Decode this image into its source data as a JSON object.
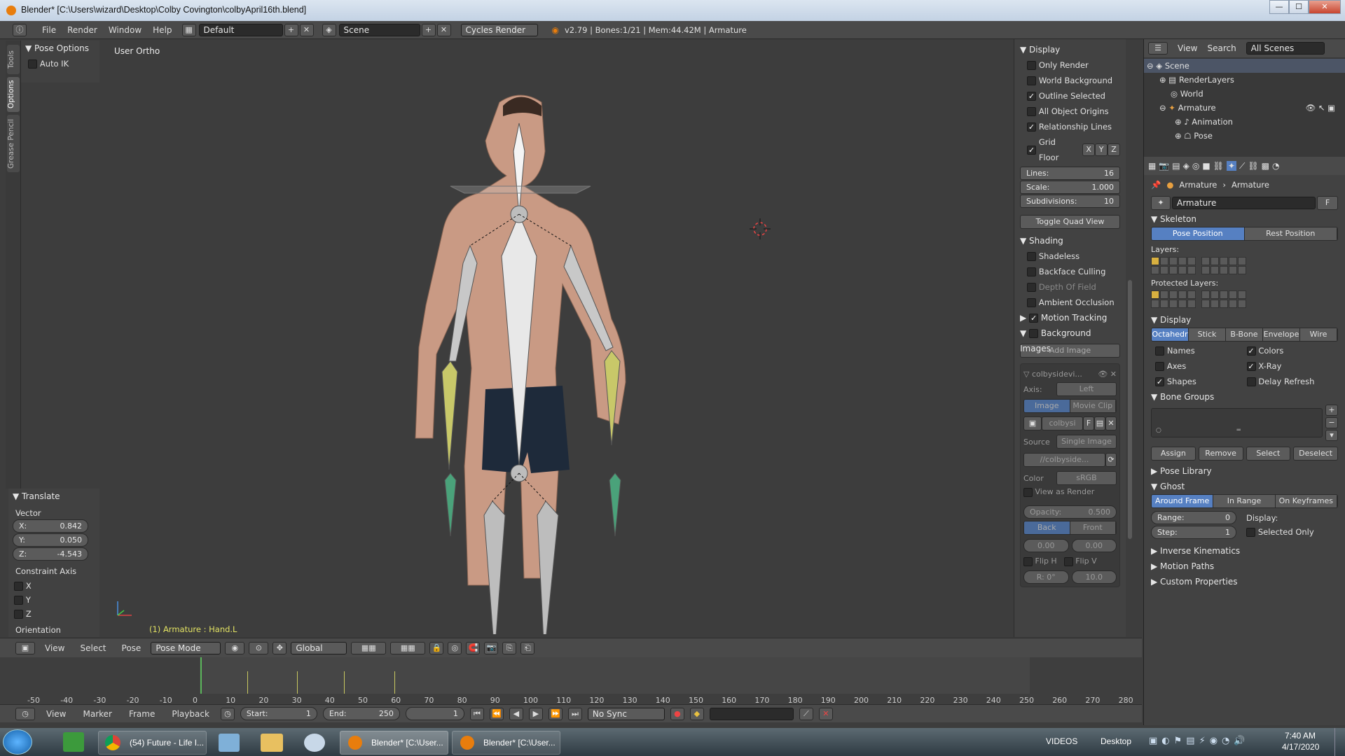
{
  "window": {
    "title": "Blender* [C:\\Users\\wizard\\Desktop\\Colby Covington\\colbyApril16th.blend]",
    "min": "—",
    "max": "☐",
    "close": "✕"
  },
  "infobar": {
    "menus": [
      "File",
      "Render",
      "Window",
      "Help"
    ],
    "layout": "Default",
    "scene": "Scene",
    "engine": "Cycles Render",
    "stats": "v2.79 | Bones:1/21 | Mem:44.42M | Armature"
  },
  "tool_tabs": [
    "Tools",
    "Options",
    "Grease Pencil"
  ],
  "pose_options": {
    "title": "Pose Options",
    "auto_ik": "Auto IK"
  },
  "translate": {
    "title": "Translate",
    "vector_label": "Vector",
    "x": "X:",
    "xv": "0.842",
    "y": "Y:",
    "yv": "0.050",
    "z": "Z:",
    "zv": "-4.543",
    "constraint_label": "Constraint Axis",
    "cx": "X",
    "cy": "Y",
    "cz": "Z",
    "orientation": "Orientation"
  },
  "viewport": {
    "view_label": "User Ortho",
    "status": "(1) Armature : Hand.L"
  },
  "display_panel": {
    "title": "Display",
    "only_render": "Only Render",
    "world_bg": "World Background",
    "outline_sel": "Outline Selected",
    "all_origins": "All Object Origins",
    "rel_lines": "Relationship Lines",
    "grid_floor": "Grid Floor",
    "gx": "X",
    "gy": "Y",
    "gz": "Z",
    "lines": "Lines:",
    "lines_v": "16",
    "scale": "Scale:",
    "scale_v": "1.000",
    "subdiv": "Subdivisions:",
    "subdiv_v": "10",
    "toggle_quad": "Toggle Quad View"
  },
  "shading_panel": {
    "title": "Shading",
    "shadeless": "Shadeless",
    "backface": "Backface Culling",
    "dof": "Depth Of Field",
    "ao": "Ambient Occlusion"
  },
  "motion_tracking": "Motion Tracking",
  "bg_images": {
    "title": "Background Images",
    "add": "Add Image",
    "name": "colbysidevi...",
    "axis_label": "Axis:",
    "axis_v": "Left",
    "image": "Image",
    "movie": "Movie Clip",
    "file": "colbysi",
    "f": "F",
    "source_label": "Source",
    "source_v": "Single Image",
    "path": "//colbyside...",
    "color_label": "Color",
    "color_v": "sRGB",
    "view_render": "View as Render",
    "opacity": "Opacity:",
    "opacity_v": "0.500",
    "back": "Back",
    "front": "Front",
    "ox": "0.00",
    "oy": "0.00",
    "fliph": "Flip H",
    "flipv": "Flip V",
    "rot": "R: 0°",
    "size": "10.0"
  },
  "outliner": {
    "view": "View",
    "search": "Search",
    "scope": "All Scenes",
    "tree": [
      "Scene",
      "RenderLayers",
      "World",
      "Armature",
      "Animation",
      "Pose"
    ]
  },
  "properties": {
    "crumb1": "Armature",
    "crumb2": "Armature",
    "name": "Armature",
    "f": "F",
    "skeleton": "Skeleton",
    "pose_pos": "Pose Position",
    "rest_pos": "Rest Position",
    "layers": "Layers:",
    "protected": "Protected Layers:",
    "display": "Display",
    "modes": [
      "Octahedr",
      "Stick",
      "B-Bone",
      "Envelope",
      "Wire"
    ],
    "names": "Names",
    "colors": "Colors",
    "axes": "Axes",
    "xray": "X-Ray",
    "shapes": "Shapes",
    "delay": "Delay Refresh",
    "bone_groups": "Bone Groups",
    "assign": "Assign",
    "remove": "Remove",
    "select": "Select",
    "deselect": "Deselect",
    "pose_library": "Pose Library",
    "ghost": "Ghost",
    "ghost_modes": [
      "Around Frame",
      "In Range",
      "On Keyframes"
    ],
    "range": "Range:",
    "range_v": "0",
    "step": "Step:",
    "step_v": "1",
    "display2": "Display:",
    "selected_only": "Selected Only",
    "ik": "Inverse Kinematics",
    "motion_paths": "Motion Paths",
    "custom_props": "Custom Properties"
  },
  "vpbar": {
    "view": "View",
    "select": "Select",
    "pose": "Pose",
    "mode": "Pose Mode",
    "orient": "Global"
  },
  "timeline": {
    "ticks": [
      "-50",
      "-40",
      "-30",
      "-20",
      "-10",
      "0",
      "10",
      "20",
      "30",
      "40",
      "50",
      "60",
      "70",
      "80",
      "90",
      "100",
      "110",
      "120",
      "130",
      "140",
      "150",
      "160",
      "170",
      "180",
      "190",
      "200",
      "210",
      "220",
      "230",
      "240",
      "250",
      "260",
      "270",
      "280"
    ],
    "view": "View",
    "marker": "Marker",
    "frame": "Frame",
    "playback": "Playback",
    "start": "Start:",
    "start_v": "1",
    "end": "End:",
    "end_v": "250",
    "current": "1",
    "sync": "No Sync"
  },
  "taskbar": {
    "items": [
      "(54) Future - Life I...",
      "Blender* [C:\\User...",
      "Blender* [C:\\User..."
    ],
    "videos": "VIDEOS",
    "desktop": "Desktop",
    "time": "7:40 AM",
    "date": "4/17/2020"
  }
}
